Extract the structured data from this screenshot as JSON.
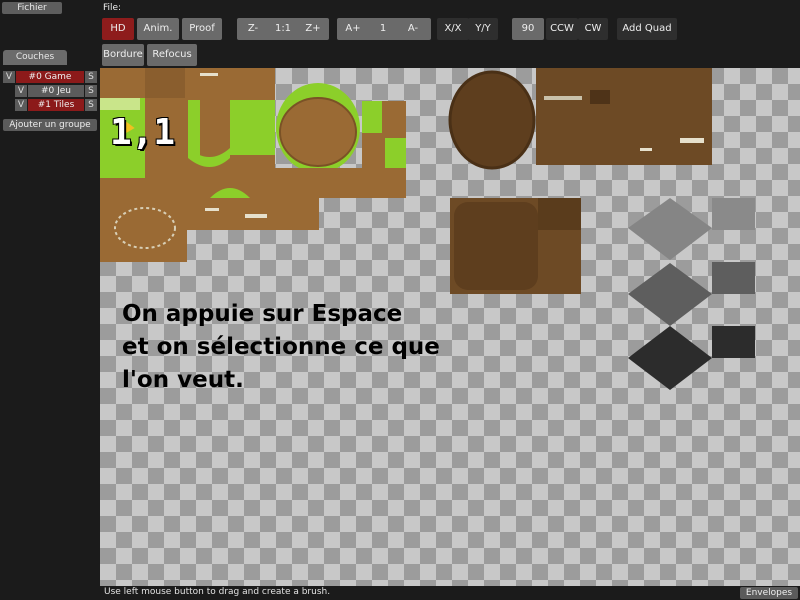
{
  "menu": {
    "file": "Fichier"
  },
  "file_label": "File:",
  "layers": {
    "tab_label": "Couches",
    "groups": [
      {
        "visibility": "V",
        "name": "#0 Game",
        "solo": "S"
      },
      {
        "visibility": "V",
        "name": "#0 Jeu",
        "solo": "S"
      },
      {
        "visibility": "V",
        "name": "#1 Tiles",
        "solo": "S"
      }
    ],
    "add_group_label": "Ajouter un groupe"
  },
  "toolbar": {
    "hd": "HD",
    "anim": "Anim.",
    "proof": "Proof",
    "zoom_out": "Z-",
    "zoom_reset": "1:1",
    "zoom_in": "Z+",
    "anim_speed_up": "A+",
    "anim_speed_value": "1",
    "anim_speed_down": "A-",
    "flip_x": "X/X",
    "flip_y": "Y/Y",
    "rotate_value": "90",
    "ccw": "CCW",
    "cw": "CW",
    "add_quad": "Add Quad",
    "border": "Bordure",
    "refocus": "Refocus"
  },
  "canvas": {
    "tile_coord": "1,1",
    "annotation": "On appuie sur Espace\net on sélectionne ce que\nl'on veut."
  },
  "status": {
    "message": "Use left mouse button to drag and create a brush.",
    "envelopes": "Envelopes"
  },
  "colors": {
    "accent_red": "#8e1c1c",
    "button_gray": "#6a6a6a",
    "dirt": "#9a6a34",
    "grass": "#8ccf2a"
  }
}
